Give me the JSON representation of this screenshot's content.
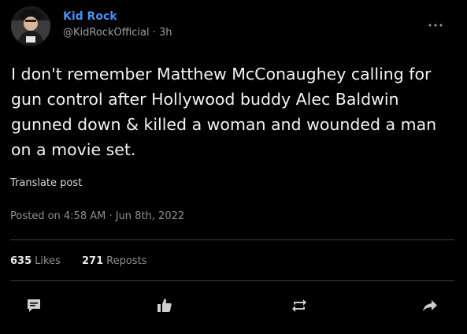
{
  "author": {
    "name": "Kid Rock",
    "handle": "@KidRockOfficial",
    "separator": "·",
    "age": "3h"
  },
  "post": {
    "text": "I don't remember Matthew McConaughey calling for gun control after Hollywood buddy Alec Baldwin gunned down & killed a woman and wounded a man on a movie set.",
    "translate_label": "Translate post",
    "posted_on": "Posted on 4:58 AM · Jun 8th, 2022"
  },
  "stats": {
    "likes_count": "635",
    "likes_label": "Likes",
    "reposts_count": "271",
    "reposts_label": "Reposts"
  },
  "icons": {
    "more": "more-options-icon",
    "reply": "comment-icon",
    "like": "thumbs-up-icon",
    "repost": "repost-icon",
    "share": "share-arrow-icon"
  },
  "colors": {
    "background": "#000000",
    "author_name": "#4b8ff4",
    "body_text": "#f2f2f2",
    "muted_text": "#8a8f94",
    "divider": "#3a3d40",
    "icon": "#cfcfcf"
  }
}
